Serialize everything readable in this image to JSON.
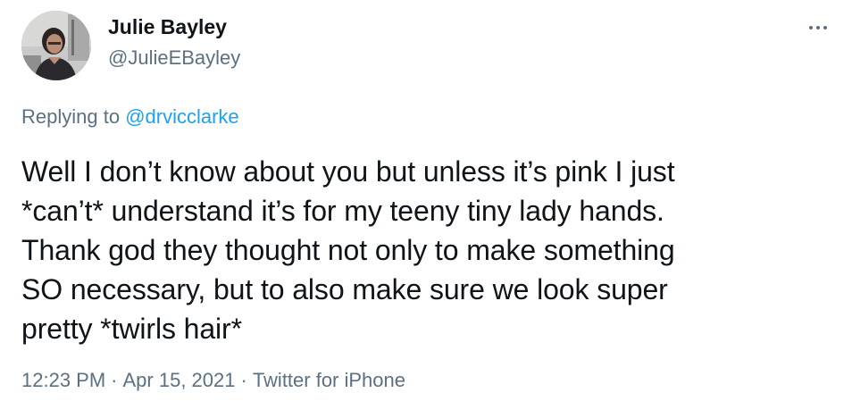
{
  "author": {
    "display_name": "Julie Bayley",
    "handle": "@JulieEBayley"
  },
  "more_icon": "more-horizontal-icon",
  "reply": {
    "prefix": "Replying to",
    "target": "@drvicclarke"
  },
  "tweet": {
    "lines": [
      "Well I don’t know about you but unless it’s pink I just",
      "*can’t* understand it’s for my teeny tiny lady hands.",
      "Thank god they thought not only to make something",
      "SO necessary, but to also make sure we look super",
      "pretty *twirls hair*"
    ]
  },
  "meta": {
    "time": "12:23 PM",
    "separator": "·",
    "date": "Apr 15, 2021",
    "source": "Twitter for iPhone"
  },
  "colors": {
    "link": "#1da1f2",
    "secondary_text": "#5b7083",
    "primary_text": "#0f1419"
  }
}
